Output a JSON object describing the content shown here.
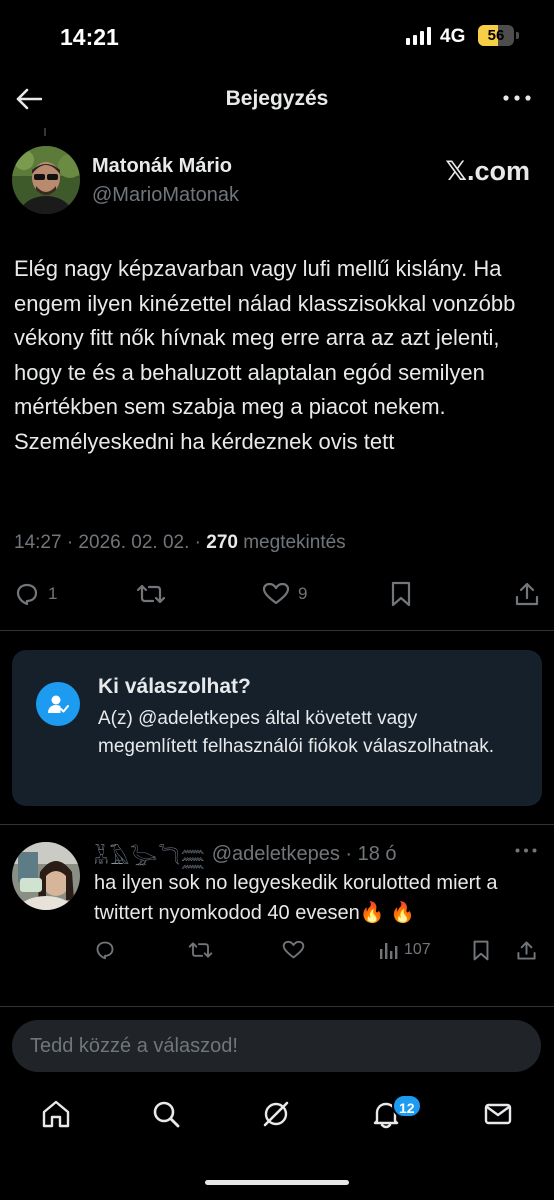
{
  "status_bar": {
    "time": "14:21",
    "network": "4G",
    "battery_level": "56",
    "battery_fraction": 0.56
  },
  "header": {
    "title": "Bejegyzés",
    "back_icon": "back-arrow-icon",
    "more_icon": "more-dots-icon"
  },
  "post": {
    "author_name": "Matonák Mário",
    "author_handle": "@MarioMatonak",
    "source": "𝕏.com",
    "text": "Elég nagy képzavarban vagy lufi mellű kislány. Ha engem ilyen kinézettel nálad klasszisokkal vonzóbb vékony fitt nők hívnak meg erre arra az azt jelenti, hogy te és a behaluzott alaptalan egód semilyen mértékben sem szabja meg a piacot nekem. Személyeskedni ha kérdeznek ovis tett",
    "timestamp": "14:27 · 2026. 02. 02. · ",
    "views_count": "270",
    "views_label": " megtekintés",
    "actions": {
      "reply_count": "1",
      "repost_count": "",
      "like_count": "9"
    }
  },
  "reply_restriction": {
    "title": "Ki válaszolhat?",
    "text": "A(z) @adeletkepes által követett vagy megemlített felhasználói fiókok válaszolhatnak.",
    "icon": "person-check-icon"
  },
  "reply": {
    "name_glyphs": "𓀡𓄿𓅬𓆓𓈗",
    "handle_time": "@adeletkepes · 18 ó",
    "text": "ha ilyen sok no legyeskedik korulotted miert a twittert nyomkodod 40 evesen🔥 🔥",
    "views_count": "107"
  },
  "compose": {
    "placeholder": "Tedd közzé a válaszod!"
  },
  "tabbar": {
    "notification_badge": "12",
    "items": [
      "home-icon",
      "search-icon",
      "grok-icon",
      "notifications-icon",
      "messages-icon"
    ]
  },
  "colors": {
    "background": "#000000",
    "accent": "#1d9bf0",
    "muted": "#71767b",
    "card": "#15202b"
  }
}
